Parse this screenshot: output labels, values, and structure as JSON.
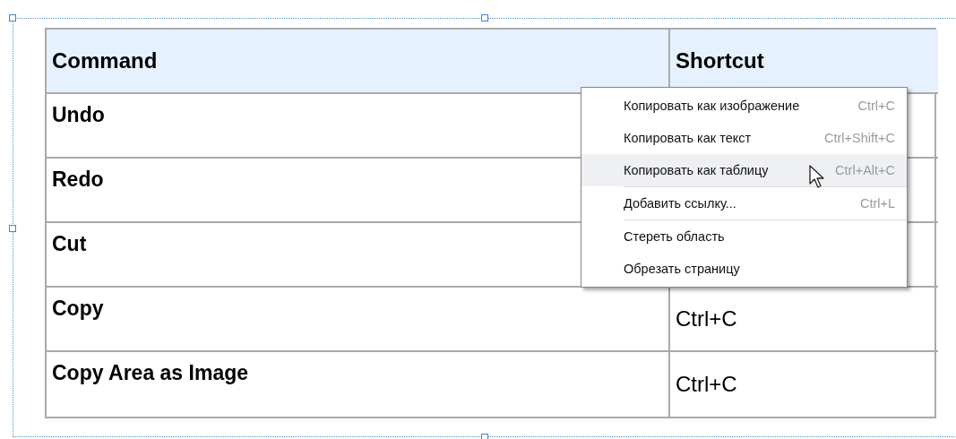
{
  "table": {
    "columns": [
      "Command",
      "Shortcut"
    ],
    "rows": [
      {
        "command": "Undo"
      },
      {
        "command": "Redo"
      },
      {
        "command": "Cut"
      },
      {
        "command": "Copy",
        "shortcut": "Ctrl+C"
      },
      {
        "command": "Copy Area as Image",
        "shortcut": "Ctrl+C"
      }
    ]
  },
  "context_menu": {
    "items": [
      {
        "kind": "item",
        "label": "Копировать как изображение",
        "shortcut": "Ctrl+C",
        "selected": false
      },
      {
        "kind": "item",
        "label": "Копировать как текст",
        "shortcut": "Ctrl+Shift+C",
        "selected": false
      },
      {
        "kind": "item",
        "label": "Копировать как таблицу",
        "shortcut": "Ctrl+Alt+C",
        "selected": true
      },
      {
        "kind": "separator"
      },
      {
        "kind": "item",
        "label": "Добавить ссылку...",
        "shortcut": "Ctrl+L",
        "selected": false
      },
      {
        "kind": "separator"
      },
      {
        "kind": "item",
        "label": "Стереть область",
        "selected": false
      },
      {
        "kind": "item",
        "label": "Обрезать страницу",
        "selected": false
      }
    ]
  }
}
